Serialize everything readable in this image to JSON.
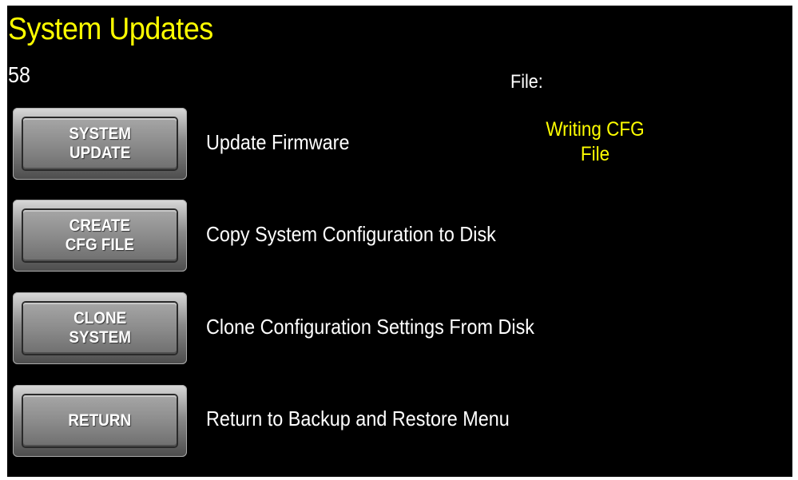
{
  "screen": {
    "title": "System Updates",
    "counter": "58",
    "file_label": "File:",
    "file_status": "Writing CFG\nFile"
  },
  "buttons": [
    {
      "label": "SYSTEM\nUPDATE",
      "description": "Update Firmware"
    },
    {
      "label": "CREATE\nCFG FILE",
      "description": "Copy System Configuration to Disk"
    },
    {
      "label": "CLONE\nSYSTEM",
      "description": "Clone Configuration Settings From Disk"
    },
    {
      "label": "RETURN",
      "description": "Return to Backup and Restore Menu"
    }
  ],
  "colors": {
    "background": "#000000",
    "title": "#ffff00",
    "status": "#ffff00",
    "text": "#ffffff"
  }
}
